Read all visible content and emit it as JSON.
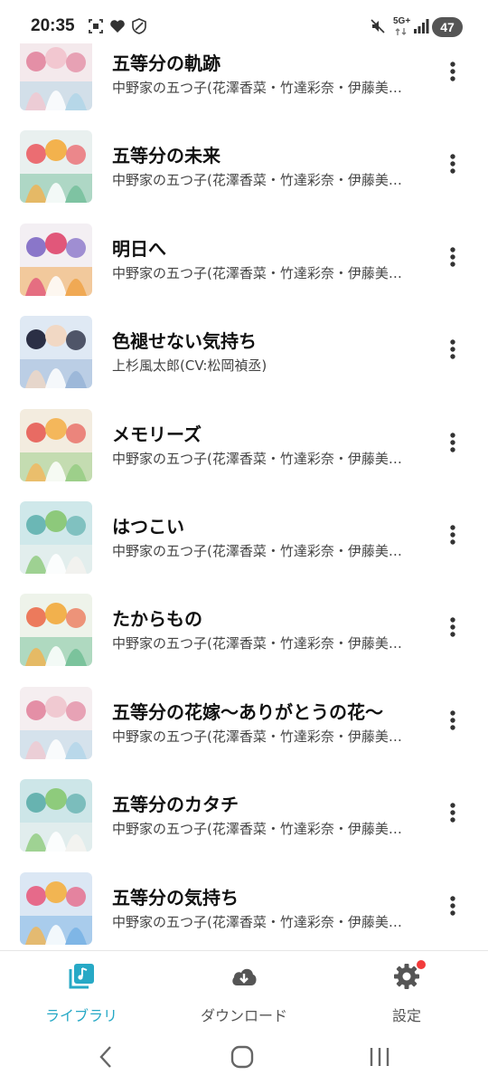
{
  "status_bar": {
    "time": "20:35",
    "network": "5G+",
    "battery": "47"
  },
  "songs": [
    {
      "title": "五等分の軌跡",
      "artist": "中野家の五つ子(花澤香菜・竹達彩奈・伊藤美来・佐倉綾音・水瀬いのり)",
      "cover_colors": [
        "#f4e9ec",
        "#e48fa6",
        "#f2c7d0",
        "#b6d7e8"
      ]
    },
    {
      "title": "五等分の未来",
      "artist": "中野家の五つ子(花澤香菜・竹達彩奈・伊藤美来・佐倉綾音・水瀬いのり)",
      "cover_colors": [
        "#e9f0ef",
        "#eb6d72",
        "#f3b24d",
        "#7ec3a2"
      ]
    },
    {
      "title": "明日へ",
      "artist": "中野家の五つ子(花澤香菜・竹達彩奈・伊藤美来・佐倉綾音・水瀬いのり)",
      "cover_colors": [
        "#f3eff3",
        "#8a76c9",
        "#e1577a",
        "#f0a954"
      ]
    },
    {
      "title": "色褪せない気持ち",
      "artist": "上杉風太郎(CV:松岡禎丞)",
      "cover_colors": [
        "#dfe9f4",
        "#2b2f45",
        "#f1d8c4",
        "#9db8d9"
      ]
    },
    {
      "title": "メモリーズ",
      "artist": "中野家の五つ子(花澤香菜・竹達彩奈・伊藤美来・佐倉綾音・水瀬いのり)",
      "cover_colors": [
        "#f3ecdf",
        "#e86b63",
        "#f4b75b",
        "#9dcf8a"
      ]
    },
    {
      "title": "はつこい",
      "artist": "中野家の五つ子(花澤香菜・竹達彩奈・伊藤美来・佐倉綾音・水瀬いのり)",
      "cover_colors": [
        "#cfe8ea",
        "#6bb7b5",
        "#8dc97b",
        "#f2f2ef"
      ]
    },
    {
      "title": "たからもの",
      "artist": "中野家の五つ子(花澤香菜・竹達彩奈・伊藤美来・佐倉綾音・水瀬いのり)",
      "cover_colors": [
        "#eef3ea",
        "#ec7a5c",
        "#f2b14d",
        "#7bc39c"
      ]
    },
    {
      "title": "五等分の花嫁〜ありがとうの花〜",
      "artist": "中野家の五つ子(花澤香菜・竹達彩奈・伊藤美来・佐倉綾音・水瀬いのり)",
      "cover_colors": [
        "#f5eef0",
        "#e48fa6",
        "#f0c9d1",
        "#b9d8ea"
      ]
    },
    {
      "title": "五等分のカタチ",
      "artist": "中野家の五つ子(花澤香菜・竹達彩奈・伊藤美来・佐倉綾音・水瀬いのり)",
      "cover_colors": [
        "#cde6e8",
        "#67b3b0",
        "#8ecb7c",
        "#f3f3f0"
      ]
    },
    {
      "title": "五等分の気持ち",
      "artist": "中野家の五つ子(花澤香菜・竹達彩奈・伊藤美来・佐倉綾音・水瀬いのり)",
      "cover_colors": [
        "#dbe7f4",
        "#e66a8a",
        "#f2b552",
        "#7fb6e6"
      ]
    }
  ],
  "more_icon": "more-vertical-icon",
  "bottom_nav": {
    "library": {
      "label": "ライブラリ",
      "icon": "music-library-icon"
    },
    "download": {
      "label": "ダウンロード",
      "icon": "cloud-download-icon"
    },
    "settings": {
      "label": "設定",
      "icon": "gear-icon"
    }
  },
  "colors": {
    "accent": "#27a9c6",
    "inactive": "#555555",
    "badge": "#f23b3b"
  }
}
